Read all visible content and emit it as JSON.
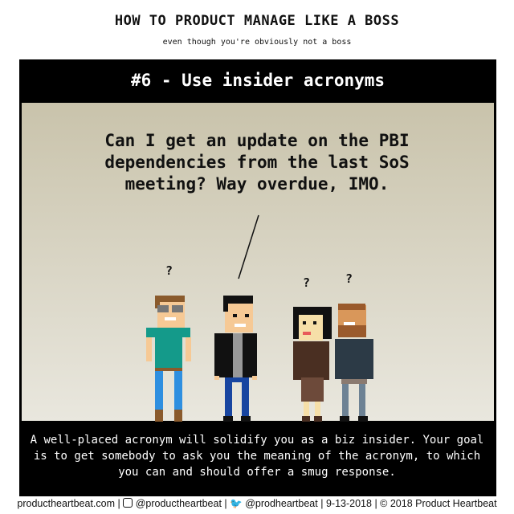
{
  "title": "HOW TO PRODUCT MANAGE LIKE A BOSS",
  "subtitle": "even though you're obviously not a boss",
  "panel_header": "#6 - Use insider acronyms",
  "speech": [
    "Can I get an update on the PBI",
    "dependencies from the last SoS",
    "meeting? Way overdue, IMO."
  ],
  "question_mark": "?",
  "caption": "A well-placed acronym will solidify you as a biz insider. Your goal is to get somebody to ask you the meaning of the acronym, to which you can and should offer a smug response.",
  "footer": {
    "website": "productheartbeat.com",
    "instagram": "@productheartbeat",
    "twitter": "@prodheartbeat",
    "date": "9-13-2018",
    "copyright": "© 2018 Product Heartbeat",
    "sep": "|"
  }
}
